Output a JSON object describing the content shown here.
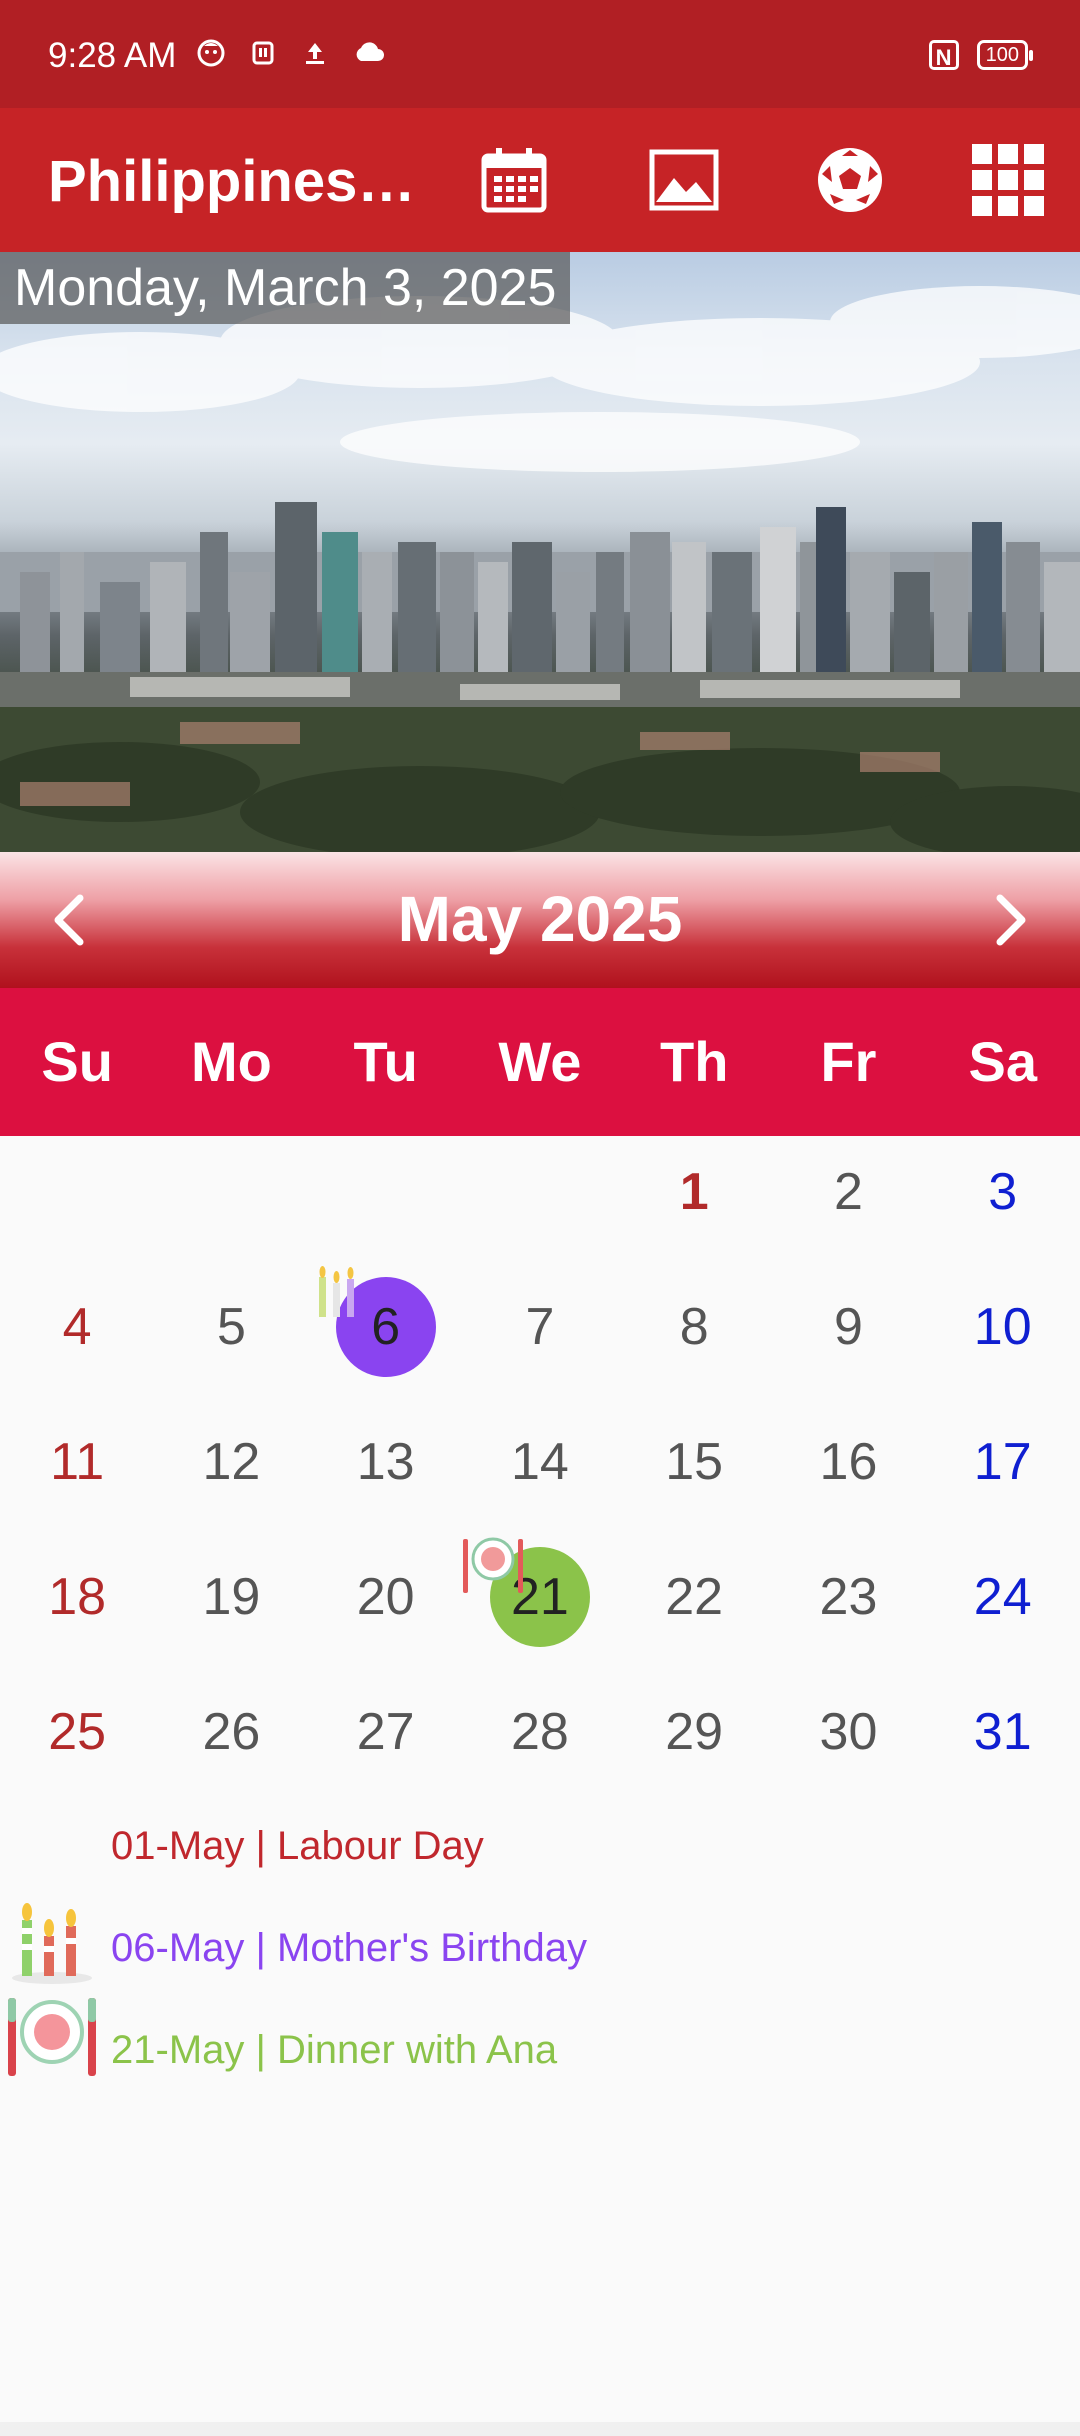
{
  "status_bar": {
    "time": "9:28 AM",
    "battery": "100",
    "nfc": "N"
  },
  "app_bar": {
    "title": "Philippines…",
    "actions": [
      "calendar-icon",
      "image-icon",
      "soccer-ball-icon",
      "grid-menu-icon"
    ]
  },
  "hero": {
    "date": "Monday, March 3, 2025"
  },
  "calendar": {
    "month_label": "May 2025",
    "weekdays": [
      "Su",
      "Mo",
      "Tu",
      "We",
      "Th",
      "Fr",
      "Sa"
    ],
    "weeks": [
      [
        "",
        "",
        "",
        "",
        "1",
        "2",
        "3"
      ],
      [
        "4",
        "5",
        "6",
        "7",
        "8",
        "9",
        "10"
      ],
      [
        "11",
        "12",
        "13",
        "14",
        "15",
        "16",
        "17"
      ],
      [
        "18",
        "19",
        "20",
        "21",
        "22",
        "23",
        "24"
      ],
      [
        "25",
        "26",
        "27",
        "28",
        "29",
        "30",
        "31"
      ]
    ],
    "colors": {
      "sunday": "#b12a2a",
      "saturday": "#0f1fd1",
      "weekday": "#555555",
      "birthday_marker": "#8a44f0",
      "dinner_marker": "#8bc34a"
    }
  },
  "events": [
    {
      "label": "01-May | Labour Day",
      "color": "#c0272d",
      "icon": ""
    },
    {
      "label": "06-May | Mother's Birthday",
      "color": "#8a44f0",
      "icon": "birthday-candles-icon"
    },
    {
      "label": "21-May | Dinner with Ana",
      "color": "#8bc34a",
      "icon": "dinner-plate-icon"
    }
  ]
}
